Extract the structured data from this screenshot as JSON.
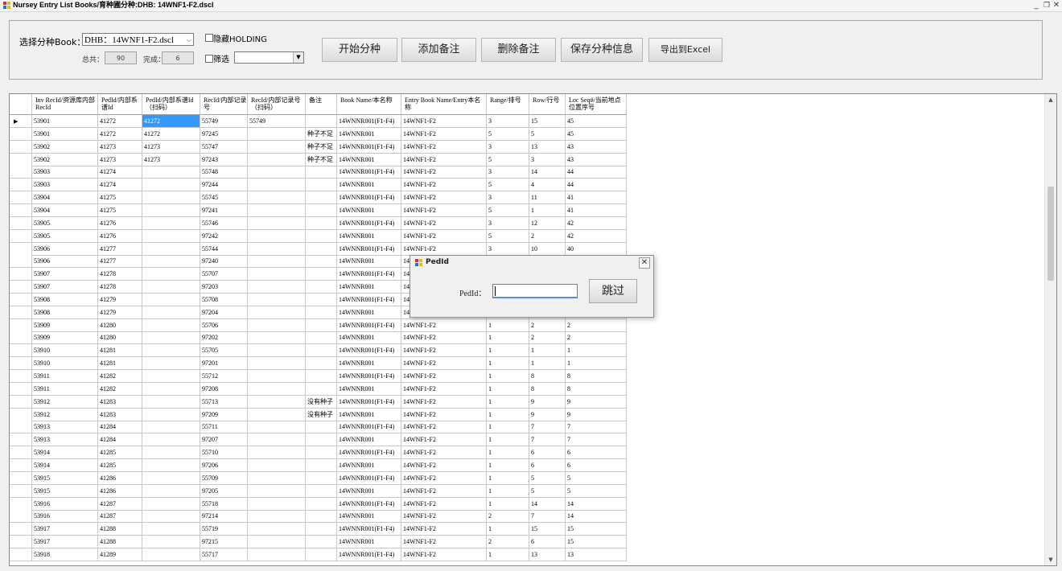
{
  "window": {
    "title": "Nursey Entry List Books/育种圃分种:DHB:  14WNF1-F2.dscl",
    "minimize": "_",
    "maximize": "❐",
    "close": "✕"
  },
  "toolbar": {
    "book_label": "选择分种Book：",
    "book_value": "DHB：14WNF1-F2.dscl",
    "total_label": "总共：",
    "total_value": "90",
    "done_label": "完成：",
    "done_value": "6",
    "hide_holding_label": "隐藏HOLDING",
    "filter_label": "筛选",
    "filter_value": "",
    "buttons": [
      "开始分种",
      "添加备注",
      "删除备注",
      "保存分种信息",
      "导出到Excel"
    ]
  },
  "grid": {
    "columns": [
      "Inv RecId/资源库内部RecId",
      "PedId/内部系谱Id",
      "PedId/内部系谱Id（扫码）",
      "RecId/内部记录号",
      "RecId/内部记录号（扫码）",
      "备注",
      "Book Name/本名称",
      "Entry Book Name/Entry本名称",
      "Range/排号",
      "Row/行号",
      "Loc Seq#/当前地点位置序号"
    ],
    "rows": [
      [
        "53901",
        "41272",
        "41272",
        "55749",
        "55749",
        "",
        "14WNNR001(F1-F4)",
        "14WNF1-F2",
        "3",
        "15",
        "45"
      ],
      [
        "53901",
        "41272",
        "41272",
        "97245",
        "",
        "种子不足",
        "14WNNR001",
        "14WNF1-F2",
        "5",
        "5",
        "45"
      ],
      [
        "53902",
        "41273",
        "41273",
        "55747",
        "",
        "种子不足",
        "14WNNR001(F1-F4)",
        "14WNF1-F2",
        "3",
        "13",
        "43"
      ],
      [
        "53902",
        "41273",
        "41273",
        "97243",
        "",
        "种子不足",
        "14WNNR001",
        "14WNF1-F2",
        "5",
        "3",
        "43"
      ],
      [
        "53903",
        "41274",
        "",
        "55748",
        "",
        "",
        "14WNNR001(F1-F4)",
        "14WNF1-F2",
        "3",
        "14",
        "44"
      ],
      [
        "53903",
        "41274",
        "",
        "97244",
        "",
        "",
        "14WNNR001",
        "14WNF1-F2",
        "5",
        "4",
        "44"
      ],
      [
        "53904",
        "41275",
        "",
        "55745",
        "",
        "",
        "14WNNR001(F1-F4)",
        "14WNF1-F2",
        "3",
        "11",
        "41"
      ],
      [
        "53904",
        "41275",
        "",
        "97241",
        "",
        "",
        "14WNNR001",
        "14WNF1-F2",
        "5",
        "1",
        "41"
      ],
      [
        "53905",
        "41276",
        "",
        "55746",
        "",
        "",
        "14WNNR001(F1-F4)",
        "14WNF1-F2",
        "3",
        "12",
        "42"
      ],
      [
        "53905",
        "41276",
        "",
        "97242",
        "",
        "",
        "14WNNR001",
        "14WNF1-F2",
        "5",
        "2",
        "42"
      ],
      [
        "53906",
        "41277",
        "",
        "55744",
        "",
        "",
        "14WNNR001(F1-F4)",
        "14WNF1-F2",
        "3",
        "10",
        "40"
      ],
      [
        "53906",
        "41277",
        "",
        "97240",
        "",
        "",
        "14WNNR001",
        "14",
        "",
        "",
        ""
      ],
      [
        "53907",
        "41278",
        "",
        "55707",
        "",
        "",
        "14WNNR001(F1-F4)",
        "14",
        "",
        "",
        ""
      ],
      [
        "53907",
        "41278",
        "",
        "97203",
        "",
        "",
        "14WNNR001",
        "14",
        "",
        "",
        ""
      ],
      [
        "53908",
        "41279",
        "",
        "55708",
        "",
        "",
        "14WNNR001(F1-F4)",
        "14",
        "",
        "",
        ""
      ],
      [
        "53908",
        "41279",
        "",
        "97204",
        "",
        "",
        "14WNNR001",
        "14",
        "",
        "",
        ""
      ],
      [
        "53909",
        "41280",
        "",
        "55706",
        "",
        "",
        "14WNNR001(F1-F4)",
        "14WNF1-F2",
        "1",
        "2",
        "2"
      ],
      [
        "53909",
        "41280",
        "",
        "97202",
        "",
        "",
        "14WNNR001",
        "14WNF1-F2",
        "1",
        "2",
        "2"
      ],
      [
        "53910",
        "41281",
        "",
        "55705",
        "",
        "",
        "14WNNR001(F1-F4)",
        "14WNF1-F2",
        "1",
        "1",
        "1"
      ],
      [
        "53910",
        "41281",
        "",
        "97201",
        "",
        "",
        "14WNNR001",
        "14WNF1-F2",
        "1",
        "1",
        "1"
      ],
      [
        "53911",
        "41282",
        "",
        "55712",
        "",
        "",
        "14WNNR001(F1-F4)",
        "14WNF1-F2",
        "1",
        "8",
        "8"
      ],
      [
        "53911",
        "41282",
        "",
        "97208",
        "",
        "",
        "14WNNR001",
        "14WNF1-F2",
        "1",
        "8",
        "8"
      ],
      [
        "53912",
        "41283",
        "",
        "55713",
        "",
        "没有种子",
        "14WNNR001(F1-F4)",
        "14WNF1-F2",
        "1",
        "9",
        "9"
      ],
      [
        "53912",
        "41283",
        "",
        "97209",
        "",
        "没有种子",
        "14WNNR001",
        "14WNF1-F2",
        "1",
        "9",
        "9"
      ],
      [
        "53913",
        "41284",
        "",
        "55711",
        "",
        "",
        "14WNNR001(F1-F4)",
        "14WNF1-F2",
        "1",
        "7",
        "7"
      ],
      [
        "53913",
        "41284",
        "",
        "97207",
        "",
        "",
        "14WNNR001",
        "14WNF1-F2",
        "1",
        "7",
        "7"
      ],
      [
        "53914",
        "41285",
        "",
        "55710",
        "",
        "",
        "14WNNR001(F1-F4)",
        "14WNF1-F2",
        "1",
        "6",
        "6"
      ],
      [
        "53914",
        "41285",
        "",
        "97206",
        "",
        "",
        "14WNNR001",
        "14WNF1-F2",
        "1",
        "6",
        "6"
      ],
      [
        "53915",
        "41286",
        "",
        "55709",
        "",
        "",
        "14WNNR001(F1-F4)",
        "14WNF1-F2",
        "1",
        "5",
        "5"
      ],
      [
        "53915",
        "41286",
        "",
        "97205",
        "",
        "",
        "14WNNR001",
        "14WNF1-F2",
        "1",
        "5",
        "5"
      ],
      [
        "53916",
        "41287",
        "",
        "55718",
        "",
        "",
        "14WNNR001(F1-F4)",
        "14WNF1-F2",
        "1",
        "14",
        "14"
      ],
      [
        "53916",
        "41287",
        "",
        "97214",
        "",
        "",
        "14WNNR001",
        "14WNF1-F2",
        "2",
        "7",
        "14"
      ],
      [
        "53917",
        "41288",
        "",
        "55719",
        "",
        "",
        "14WNNR001(F1-F4)",
        "14WNF1-F2",
        "1",
        "15",
        "15"
      ],
      [
        "53917",
        "41288",
        "",
        "97215",
        "",
        "",
        "14WNNR001",
        "14WNF1-F2",
        "2",
        "6",
        "15"
      ],
      [
        "53918",
        "41289",
        "",
        "55717",
        "",
        "",
        "14WNNR001(F1-F4)",
        "14WNF1-F2",
        "1",
        "13",
        "13"
      ]
    ],
    "selected_row": 0,
    "selected_col": 2
  },
  "dialog": {
    "title": "PedId",
    "label": "PedId：",
    "input_value": "",
    "button": "跳过",
    "close": "✕"
  },
  "colors": {
    "selection": "#3399ff",
    "icon_red": "#d9302c",
    "icon_yellow": "#f2b51b",
    "icon_blue": "#2d6fd2"
  }
}
